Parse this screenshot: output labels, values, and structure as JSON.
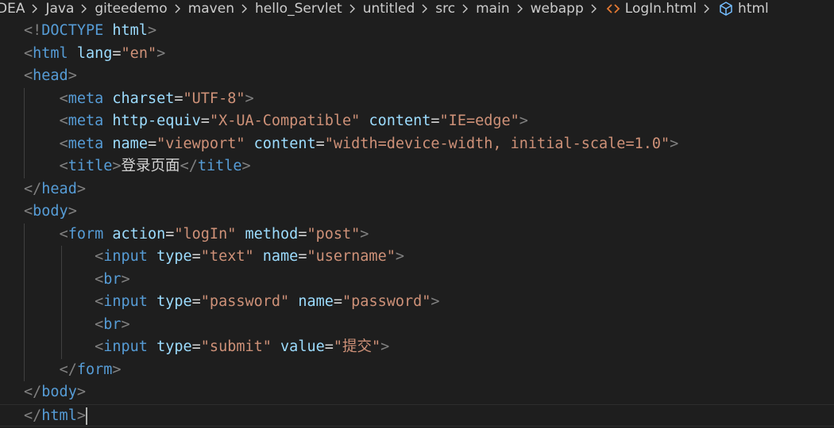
{
  "breadcrumb": {
    "items": [
      {
        "label": "DEA",
        "icon": null
      },
      {
        "label": "Java",
        "icon": null
      },
      {
        "label": "giteedemo",
        "icon": null
      },
      {
        "label": "maven",
        "icon": null
      },
      {
        "label": "hello_Servlet",
        "icon": null
      },
      {
        "label": "untitled",
        "icon": null
      },
      {
        "label": "src",
        "icon": null
      },
      {
        "label": "main",
        "icon": null
      },
      {
        "label": "webapp",
        "icon": null
      },
      {
        "label": "LogIn.html",
        "icon": "html-file-icon"
      },
      {
        "label": "html",
        "icon": "element-cube-icon"
      }
    ]
  },
  "editor": {
    "lines": [
      [
        [
          "p",
          "<!"
        ],
        [
          "tag",
          "DOCTYPE"
        ],
        [
          "t",
          " "
        ],
        [
          "attr",
          "html"
        ],
        [
          "p",
          ">"
        ]
      ],
      [
        [
          "p",
          "<"
        ],
        [
          "tag",
          "html"
        ],
        [
          "t",
          " "
        ],
        [
          "attr",
          "lang"
        ],
        [
          "t",
          "="
        ],
        [
          "str",
          "\"en\""
        ],
        [
          "p",
          ">"
        ]
      ],
      [
        [
          "p",
          "<"
        ],
        [
          "tag",
          "head"
        ],
        [
          "p",
          ">"
        ]
      ],
      [
        [
          "t",
          "    "
        ],
        [
          "p",
          "<"
        ],
        [
          "tag",
          "meta"
        ],
        [
          "t",
          " "
        ],
        [
          "attr",
          "charset"
        ],
        [
          "t",
          "="
        ],
        [
          "str",
          "\"UTF-8\""
        ],
        [
          "p",
          ">"
        ]
      ],
      [
        [
          "t",
          "    "
        ],
        [
          "p",
          "<"
        ],
        [
          "tag",
          "meta"
        ],
        [
          "t",
          " "
        ],
        [
          "attr",
          "http-equiv"
        ],
        [
          "t",
          "="
        ],
        [
          "str",
          "\"X-UA-Compatible\""
        ],
        [
          "t",
          " "
        ],
        [
          "attr",
          "content"
        ],
        [
          "t",
          "="
        ],
        [
          "str",
          "\"IE=edge\""
        ],
        [
          "p",
          ">"
        ]
      ],
      [
        [
          "t",
          "    "
        ],
        [
          "p",
          "<"
        ],
        [
          "tag",
          "meta"
        ],
        [
          "t",
          " "
        ],
        [
          "attr",
          "name"
        ],
        [
          "t",
          "="
        ],
        [
          "str",
          "\"viewport\""
        ],
        [
          "t",
          " "
        ],
        [
          "attr",
          "content"
        ],
        [
          "t",
          "="
        ],
        [
          "str",
          "\"width=device-width, initial-scale=1.0\""
        ],
        [
          "p",
          ">"
        ]
      ],
      [
        [
          "t",
          "    "
        ],
        [
          "p",
          "<"
        ],
        [
          "tag",
          "title"
        ],
        [
          "p",
          ">"
        ],
        [
          "t",
          "登录页面"
        ],
        [
          "p",
          "</"
        ],
        [
          "tag",
          "title"
        ],
        [
          "p",
          ">"
        ]
      ],
      [
        [
          "p",
          "</"
        ],
        [
          "tag",
          "head"
        ],
        [
          "p",
          ">"
        ]
      ],
      [
        [
          "p",
          "<"
        ],
        [
          "tag",
          "body"
        ],
        [
          "p",
          ">"
        ]
      ],
      [
        [
          "t",
          "    "
        ],
        [
          "p",
          "<"
        ],
        [
          "tag",
          "form"
        ],
        [
          "t",
          " "
        ],
        [
          "attr",
          "action"
        ],
        [
          "t",
          "="
        ],
        [
          "str",
          "\"logIn\""
        ],
        [
          "t",
          " "
        ],
        [
          "attr",
          "method"
        ],
        [
          "t",
          "="
        ],
        [
          "str",
          "\"post\""
        ],
        [
          "p",
          ">"
        ]
      ],
      [
        [
          "t",
          "        "
        ],
        [
          "p",
          "<"
        ],
        [
          "tag",
          "input"
        ],
        [
          "t",
          " "
        ],
        [
          "attr",
          "type"
        ],
        [
          "t",
          "="
        ],
        [
          "str",
          "\"text\""
        ],
        [
          "t",
          " "
        ],
        [
          "attr",
          "name"
        ],
        [
          "t",
          "="
        ],
        [
          "str",
          "\"username\""
        ],
        [
          "p",
          ">"
        ]
      ],
      [
        [
          "t",
          "        "
        ],
        [
          "p",
          "<"
        ],
        [
          "tag",
          "br"
        ],
        [
          "p",
          ">"
        ]
      ],
      [
        [
          "t",
          "        "
        ],
        [
          "p",
          "<"
        ],
        [
          "tag",
          "input"
        ],
        [
          "t",
          " "
        ],
        [
          "attr",
          "type"
        ],
        [
          "t",
          "="
        ],
        [
          "str",
          "\"password\""
        ],
        [
          "t",
          " "
        ],
        [
          "attr",
          "name"
        ],
        [
          "t",
          "="
        ],
        [
          "str",
          "\"password\""
        ],
        [
          "p",
          ">"
        ]
      ],
      [
        [
          "t",
          "        "
        ],
        [
          "p",
          "<"
        ],
        [
          "tag",
          "br"
        ],
        [
          "p",
          ">"
        ]
      ],
      [
        [
          "t",
          "        "
        ],
        [
          "p",
          "<"
        ],
        [
          "tag",
          "input"
        ],
        [
          "t",
          " "
        ],
        [
          "attr",
          "type"
        ],
        [
          "t",
          "="
        ],
        [
          "str",
          "\"submit\""
        ],
        [
          "t",
          " "
        ],
        [
          "attr",
          "value"
        ],
        [
          "t",
          "="
        ],
        [
          "str",
          "\"提交\""
        ],
        [
          "p",
          ">"
        ]
      ],
      [
        [
          "t",
          "    "
        ],
        [
          "p",
          "</"
        ],
        [
          "tag",
          "form"
        ],
        [
          "p",
          ">"
        ]
      ],
      [
        [
          "p",
          "</"
        ],
        [
          "tag",
          "body"
        ],
        [
          "p",
          ">"
        ]
      ],
      [
        [
          "p",
          "</"
        ],
        [
          "tag",
          "html"
        ],
        [
          "p",
          ">"
        ]
      ]
    ],
    "current_line": 17,
    "colors": {
      "background": "#1e1e1e",
      "punctuation": "#808080",
      "tag": "#569cd6",
      "attribute": "#9cdcfe",
      "string": "#ce9178",
      "text": "#d4d4d4"
    }
  }
}
